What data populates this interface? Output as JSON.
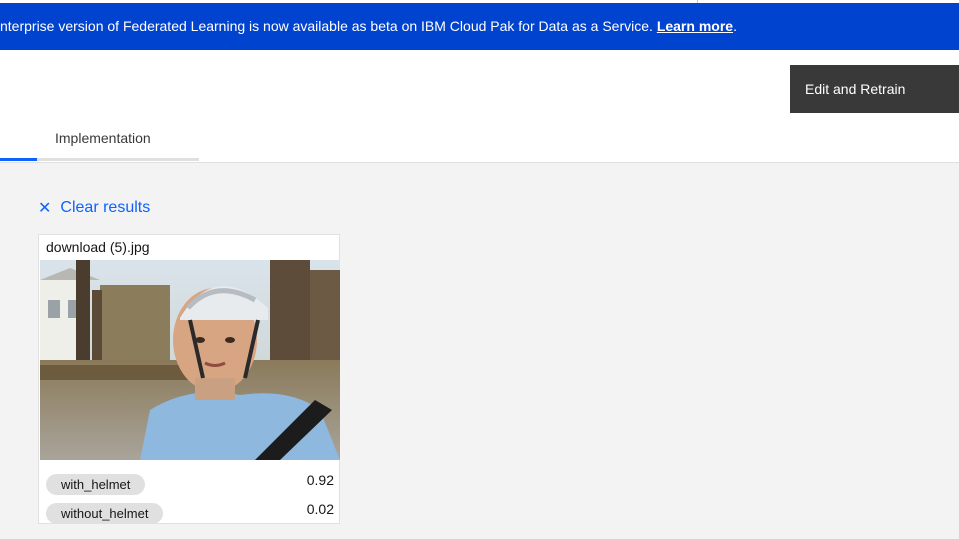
{
  "banner": {
    "text": "nterprise version of Federated Learning is now available as beta on IBM Cloud Pak for Data as a Service.",
    "link": "Learn more",
    "after_link": "."
  },
  "header": {
    "retrain_label": "Edit and Retrain",
    "tab_label": "Implementation"
  },
  "results": {
    "clear_label": "Clear results",
    "card": {
      "filename": "download (5).jpg",
      "predictions": [
        {
          "label": "with_helmet",
          "score": "0.92"
        },
        {
          "label": "without_helmet",
          "score": "0.02"
        }
      ]
    }
  },
  "colors": {
    "banner_bg": "#0043ce",
    "link": "#0f62fe",
    "button_bg": "#393939",
    "tag_bg": "#e0e0e0"
  },
  "icons": {
    "clear": "close-icon"
  }
}
